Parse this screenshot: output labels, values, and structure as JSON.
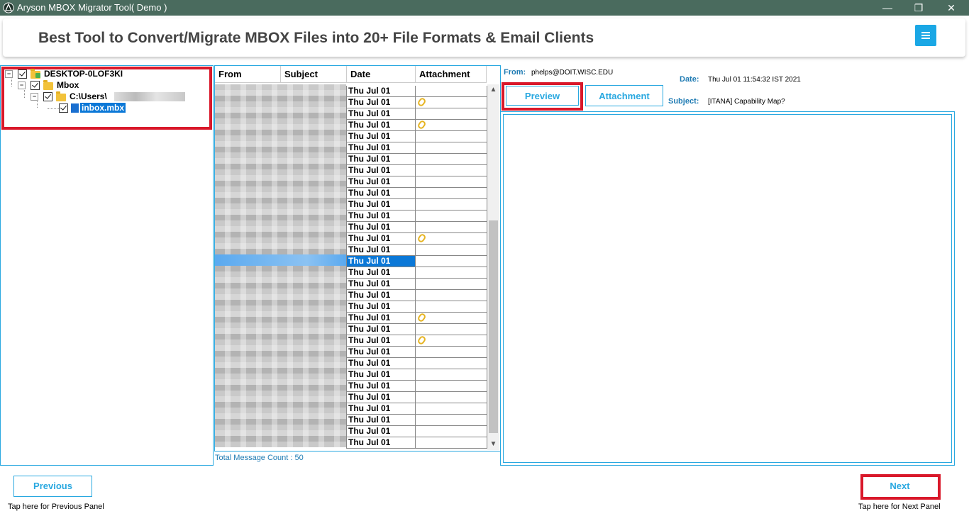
{
  "window": {
    "title": "Aryson MBOX Migrator Tool( Demo )",
    "minimize": "—",
    "maximize": "❐",
    "close": "✕"
  },
  "banner": {
    "headline": "Best Tool to Convert/Migrate MBOX Files into 20+ File Formats & Email Clients"
  },
  "tree": {
    "nodes": [
      {
        "label": "DESKTOP-0LOF3KI"
      },
      {
        "label": "Mbox"
      },
      {
        "label": "C:\\Users\\"
      },
      {
        "label": "inbox.mbx"
      }
    ]
  },
  "list": {
    "columns": [
      "From",
      "Subject",
      "Date",
      "Attachment"
    ],
    "rows": [
      {
        "date": "Thu Jul 01",
        "attachment": false
      },
      {
        "date": "Thu Jul 01",
        "attachment": true
      },
      {
        "date": "Thu Jul 01",
        "attachment": false
      },
      {
        "date": "Thu Jul 01",
        "attachment": true
      },
      {
        "date": "Thu Jul 01",
        "attachment": false
      },
      {
        "date": "Thu Jul 01",
        "attachment": false
      },
      {
        "date": "Thu Jul 01",
        "attachment": false
      },
      {
        "date": "Thu Jul 01",
        "attachment": false
      },
      {
        "date": "Thu Jul 01",
        "attachment": false
      },
      {
        "date": "Thu Jul 01",
        "attachment": false
      },
      {
        "date": "Thu Jul 01",
        "attachment": false
      },
      {
        "date": "Thu Jul 01",
        "attachment": false
      },
      {
        "date": "Thu Jul 01",
        "attachment": false
      },
      {
        "date": "Thu Jul 01",
        "attachment": true
      },
      {
        "date": "Thu Jul 01",
        "attachment": false
      },
      {
        "date": "Thu Jul 01",
        "attachment": false,
        "selected": true
      },
      {
        "date": "Thu Jul 01",
        "attachment": false
      },
      {
        "date": "Thu Jul 01",
        "attachment": false
      },
      {
        "date": "Thu Jul 01",
        "attachment": false
      },
      {
        "date": "Thu Jul 01",
        "attachment": false
      },
      {
        "date": "Thu Jul 01",
        "attachment": true
      },
      {
        "date": "Thu Jul 01",
        "attachment": false
      },
      {
        "date": "Thu Jul 01",
        "attachment": true
      },
      {
        "date": "Thu Jul 01",
        "attachment": false
      },
      {
        "date": "Thu Jul 01",
        "attachment": false
      },
      {
        "date": "Thu Jul 01",
        "attachment": false
      },
      {
        "date": "Thu Jul 01",
        "attachment": false
      },
      {
        "date": "Thu Jul 01",
        "attachment": false
      },
      {
        "date": "Thu Jul 01",
        "attachment": false
      },
      {
        "date": "Thu Jul 01",
        "attachment": false
      },
      {
        "date": "Thu Jul 01",
        "attachment": false
      },
      {
        "date": "Thu Jul 01",
        "attachment": false
      }
    ],
    "total": "Total Message Count : 50",
    "scroll_up": "▲",
    "scroll_down": "▼"
  },
  "preview": {
    "from_label": "From:",
    "from_value": "phelps@DOIT.WISC.EDU",
    "date_label": "Date:",
    "date_value": "Thu Jul 01 11:54:32 IST 2021",
    "subject_label": "Subject:",
    "subject_value": "[ITANA] Capability Map?",
    "tab_preview": "Preview",
    "tab_attachment": "Attachment"
  },
  "footer": {
    "previous_label": "Previous",
    "previous_hint": "Tap here for Previous Panel",
    "next_label": "Next",
    "next_hint": "Tap here for Next Panel"
  },
  "colors": {
    "titlebar": "#4a6b5e",
    "accent": "#29a8e0",
    "highlight": "#d9182a",
    "selection": "#0b78d7"
  }
}
